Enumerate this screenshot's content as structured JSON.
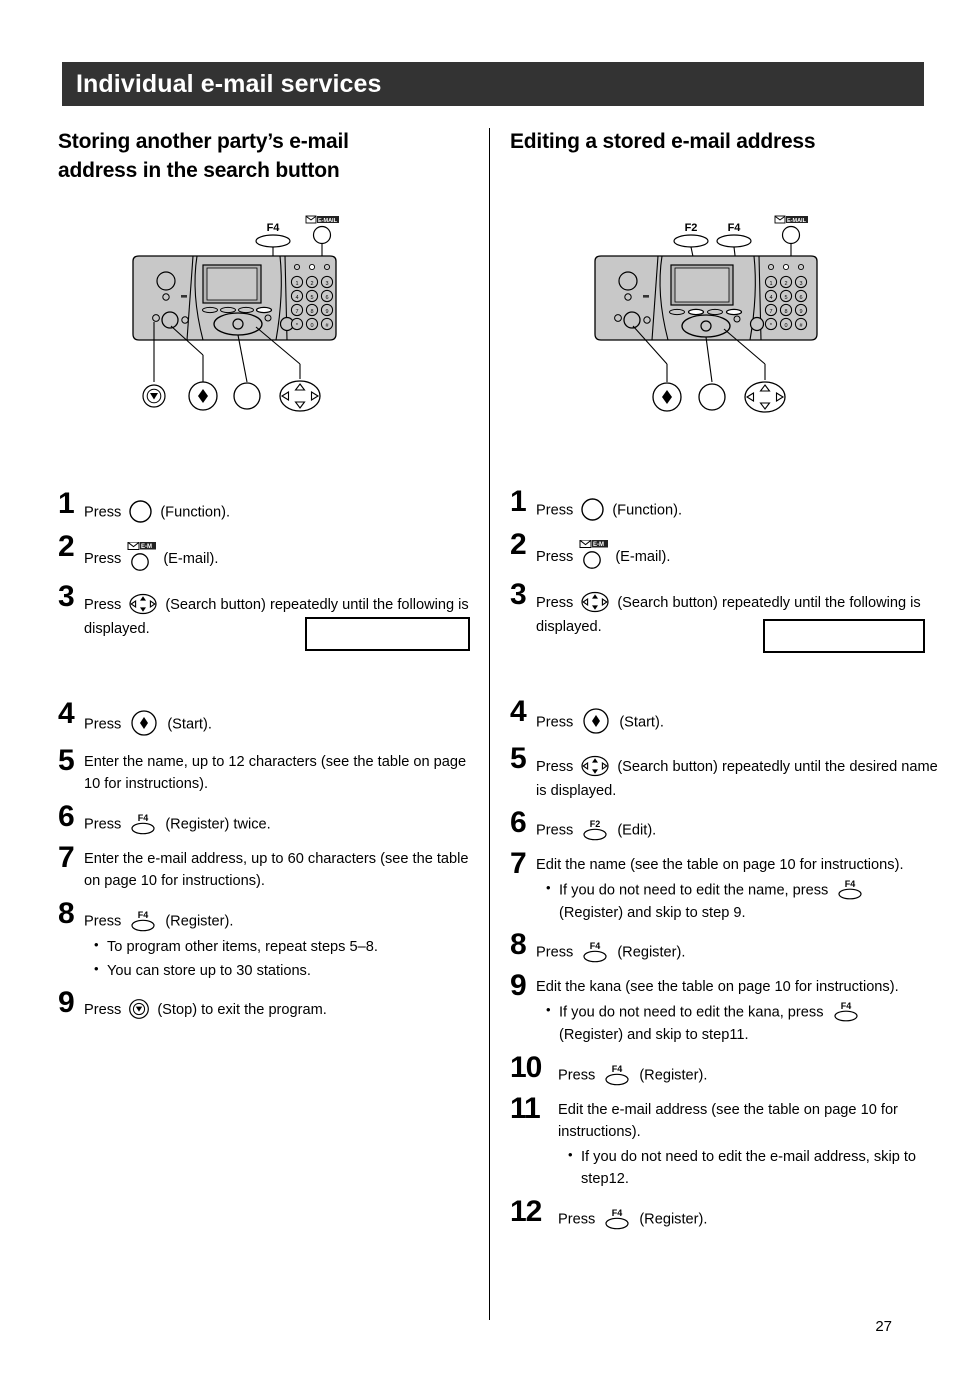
{
  "header": {
    "title": "Individual e-mail services"
  },
  "page_number": "27",
  "left": {
    "heading_line1": "Storing another party’s e-mail",
    "heading_line2": "address in the search button",
    "diagram": {
      "labels": [
        "F4"
      ],
      "email_icon_label": "E-MAIL",
      "callouts": [
        "stop-button",
        "start-button",
        "function-button",
        "search-button"
      ]
    },
    "steps": [
      {
        "num": "1",
        "text_before": "Press",
        "key": "function-button",
        "text_after": "(Function)."
      },
      {
        "num": "2",
        "text_before": "Press",
        "key": "email-button",
        "text_after": "(E-mail)."
      },
      {
        "num": "3",
        "text_before": "Press",
        "key": "search-button",
        "text_after": "(Search button) repeatedly until the following is displayed."
      },
      {
        "num": "4",
        "text_before": "Press",
        "key": "start-button",
        "text_after": "(Start)."
      },
      {
        "num": "5",
        "text_before": "Enter the name, up to 12 characters (see the table on page 10 for instructions).",
        "key": "",
        "text_after": ""
      },
      {
        "num": "6",
        "text_before": "Press",
        "key": "f4-button",
        "text_after": "(Register) twice."
      },
      {
        "num": "7",
        "text_before": "Enter the e-mail address, up to 60 characters (see the table on page 10 for instructions).",
        "key": "",
        "text_after": ""
      },
      {
        "num": "8",
        "text_before": "Press",
        "key": "f4-button",
        "text_after": "(Register).",
        "bullets": [
          "To program other items, repeat steps 5–8.",
          "You can store up to 30 stations."
        ]
      },
      {
        "num": "9",
        "text_before": "Press",
        "key": "stop-button",
        "text_after": "(Stop) to exit the program."
      }
    ]
  },
  "right": {
    "heading_line1": "Editing a stored e-mail address",
    "heading_line2": "",
    "diagram": {
      "labels": [
        "F2",
        "F4"
      ],
      "email_icon_label": "E-MAIL",
      "callouts": [
        "start-button",
        "function-button",
        "search-button"
      ]
    },
    "steps": [
      {
        "num": "1",
        "text_before": "Press",
        "key": "function-button",
        "text_after": "(Function)."
      },
      {
        "num": "2",
        "text_before": "Press",
        "key": "email-button",
        "text_after": "(E-mail)."
      },
      {
        "num": "3",
        "text_before": "Press",
        "key": "search-button",
        "text_after": "(Search button) repeatedly until the following is displayed."
      },
      {
        "num": "4",
        "text_before": "Press",
        "key": "start-button",
        "text_after": "(Start)."
      },
      {
        "num": "5",
        "text_before": "Press",
        "key": "search-button",
        "text_after": "(Search button) repeatedly until the desired name is displayed."
      },
      {
        "num": "6",
        "text_before": "Press",
        "key": "f2-button",
        "text_after": "(Edit)."
      },
      {
        "num": "7",
        "text_before": "Edit the name (see the table on page 10 for instructions).",
        "key": "",
        "text_after": "",
        "bullet_key": {
          "before": "If you do not need to edit the name, press",
          "key": "f4-button",
          "after": "(Register) and skip to step 9."
        }
      },
      {
        "num": "8",
        "text_before": "Press",
        "key": "f4-button",
        "text_after": "(Register)."
      },
      {
        "num": "9",
        "text_before": "Edit the kana (see the table on page 10 for instructions).",
        "key": "",
        "text_after": "",
        "bullet_key": {
          "before": "If you do not need to edit the kana, press",
          "key": "f4-button",
          "after": "(Register) and skip to step11."
        }
      },
      {
        "num": "10",
        "text_before": "Press",
        "key": "f4-button",
        "text_after": "(Register)."
      },
      {
        "num": "11",
        "text_before": "Edit the e-mail address (see the table on page 10 for instructions).",
        "key": "",
        "text_after": "",
        "bullets": [
          "If you do not need to edit the e-mail address, skip to step12."
        ]
      },
      {
        "num": "12",
        "text_before": "Press",
        "key": "f4-button",
        "text_after": "(Register)."
      }
    ]
  },
  "colors": {
    "title_bar_bg": "#333333",
    "title_text": "#ffffff",
    "body_text": "#000000",
    "device_body": "#c8c8c8",
    "device_lcd": "#b4b4b4",
    "page_bg": "#ffffff"
  }
}
